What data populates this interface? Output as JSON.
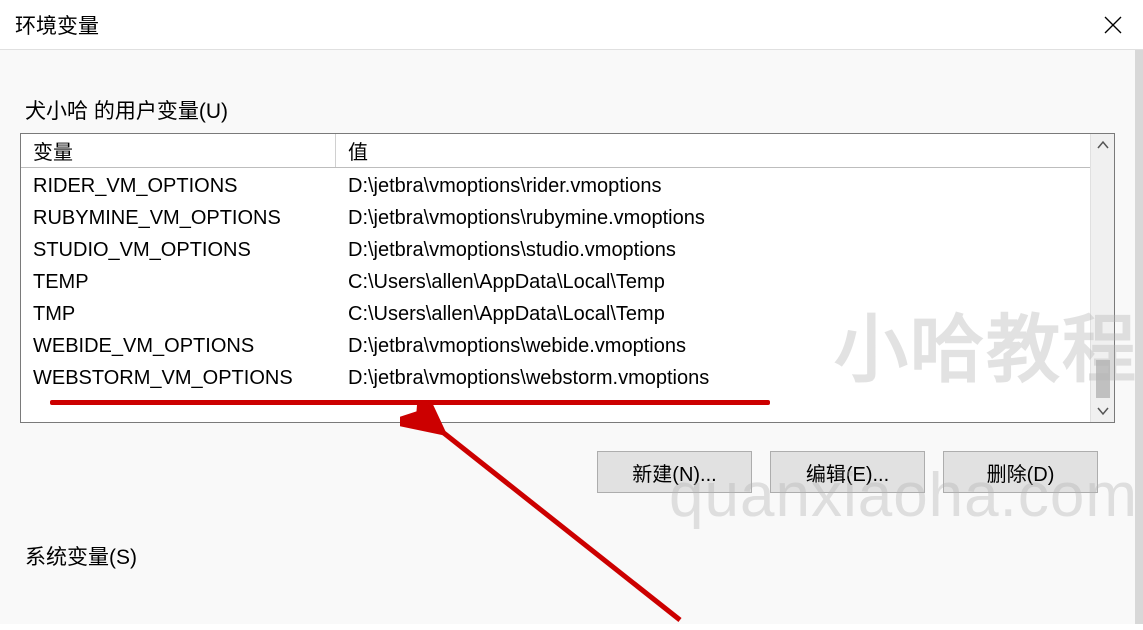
{
  "window": {
    "title": "环境变量"
  },
  "user_vars_section": {
    "label": "犬小哈 的用户变量(U)",
    "columns": {
      "name": "变量",
      "value": "值"
    },
    "rows": [
      {
        "name": "RIDER_VM_OPTIONS",
        "value": "D:\\jetbra\\vmoptions\\rider.vmoptions"
      },
      {
        "name": "RUBYMINE_VM_OPTIONS",
        "value": "D:\\jetbra\\vmoptions\\rubymine.vmoptions"
      },
      {
        "name": "STUDIO_VM_OPTIONS",
        "value": "D:\\jetbra\\vmoptions\\studio.vmoptions"
      },
      {
        "name": "TEMP",
        "value": "C:\\Users\\allen\\AppData\\Local\\Temp"
      },
      {
        "name": "TMP",
        "value": "C:\\Users\\allen\\AppData\\Local\\Temp"
      },
      {
        "name": "WEBIDE_VM_OPTIONS",
        "value": "D:\\jetbra\\vmoptions\\webide.vmoptions"
      },
      {
        "name": "WEBSTORM_VM_OPTIONS",
        "value": "D:\\jetbra\\vmoptions\\webstorm.vmoptions"
      }
    ]
  },
  "buttons": {
    "new": "新建(N)...",
    "edit": "编辑(E)...",
    "delete": "删除(D)"
  },
  "system_vars_section": {
    "label": "系统变量(S)"
  },
  "watermarks": {
    "w1": "小哈教程",
    "w2": "quanxiaoha.com"
  }
}
